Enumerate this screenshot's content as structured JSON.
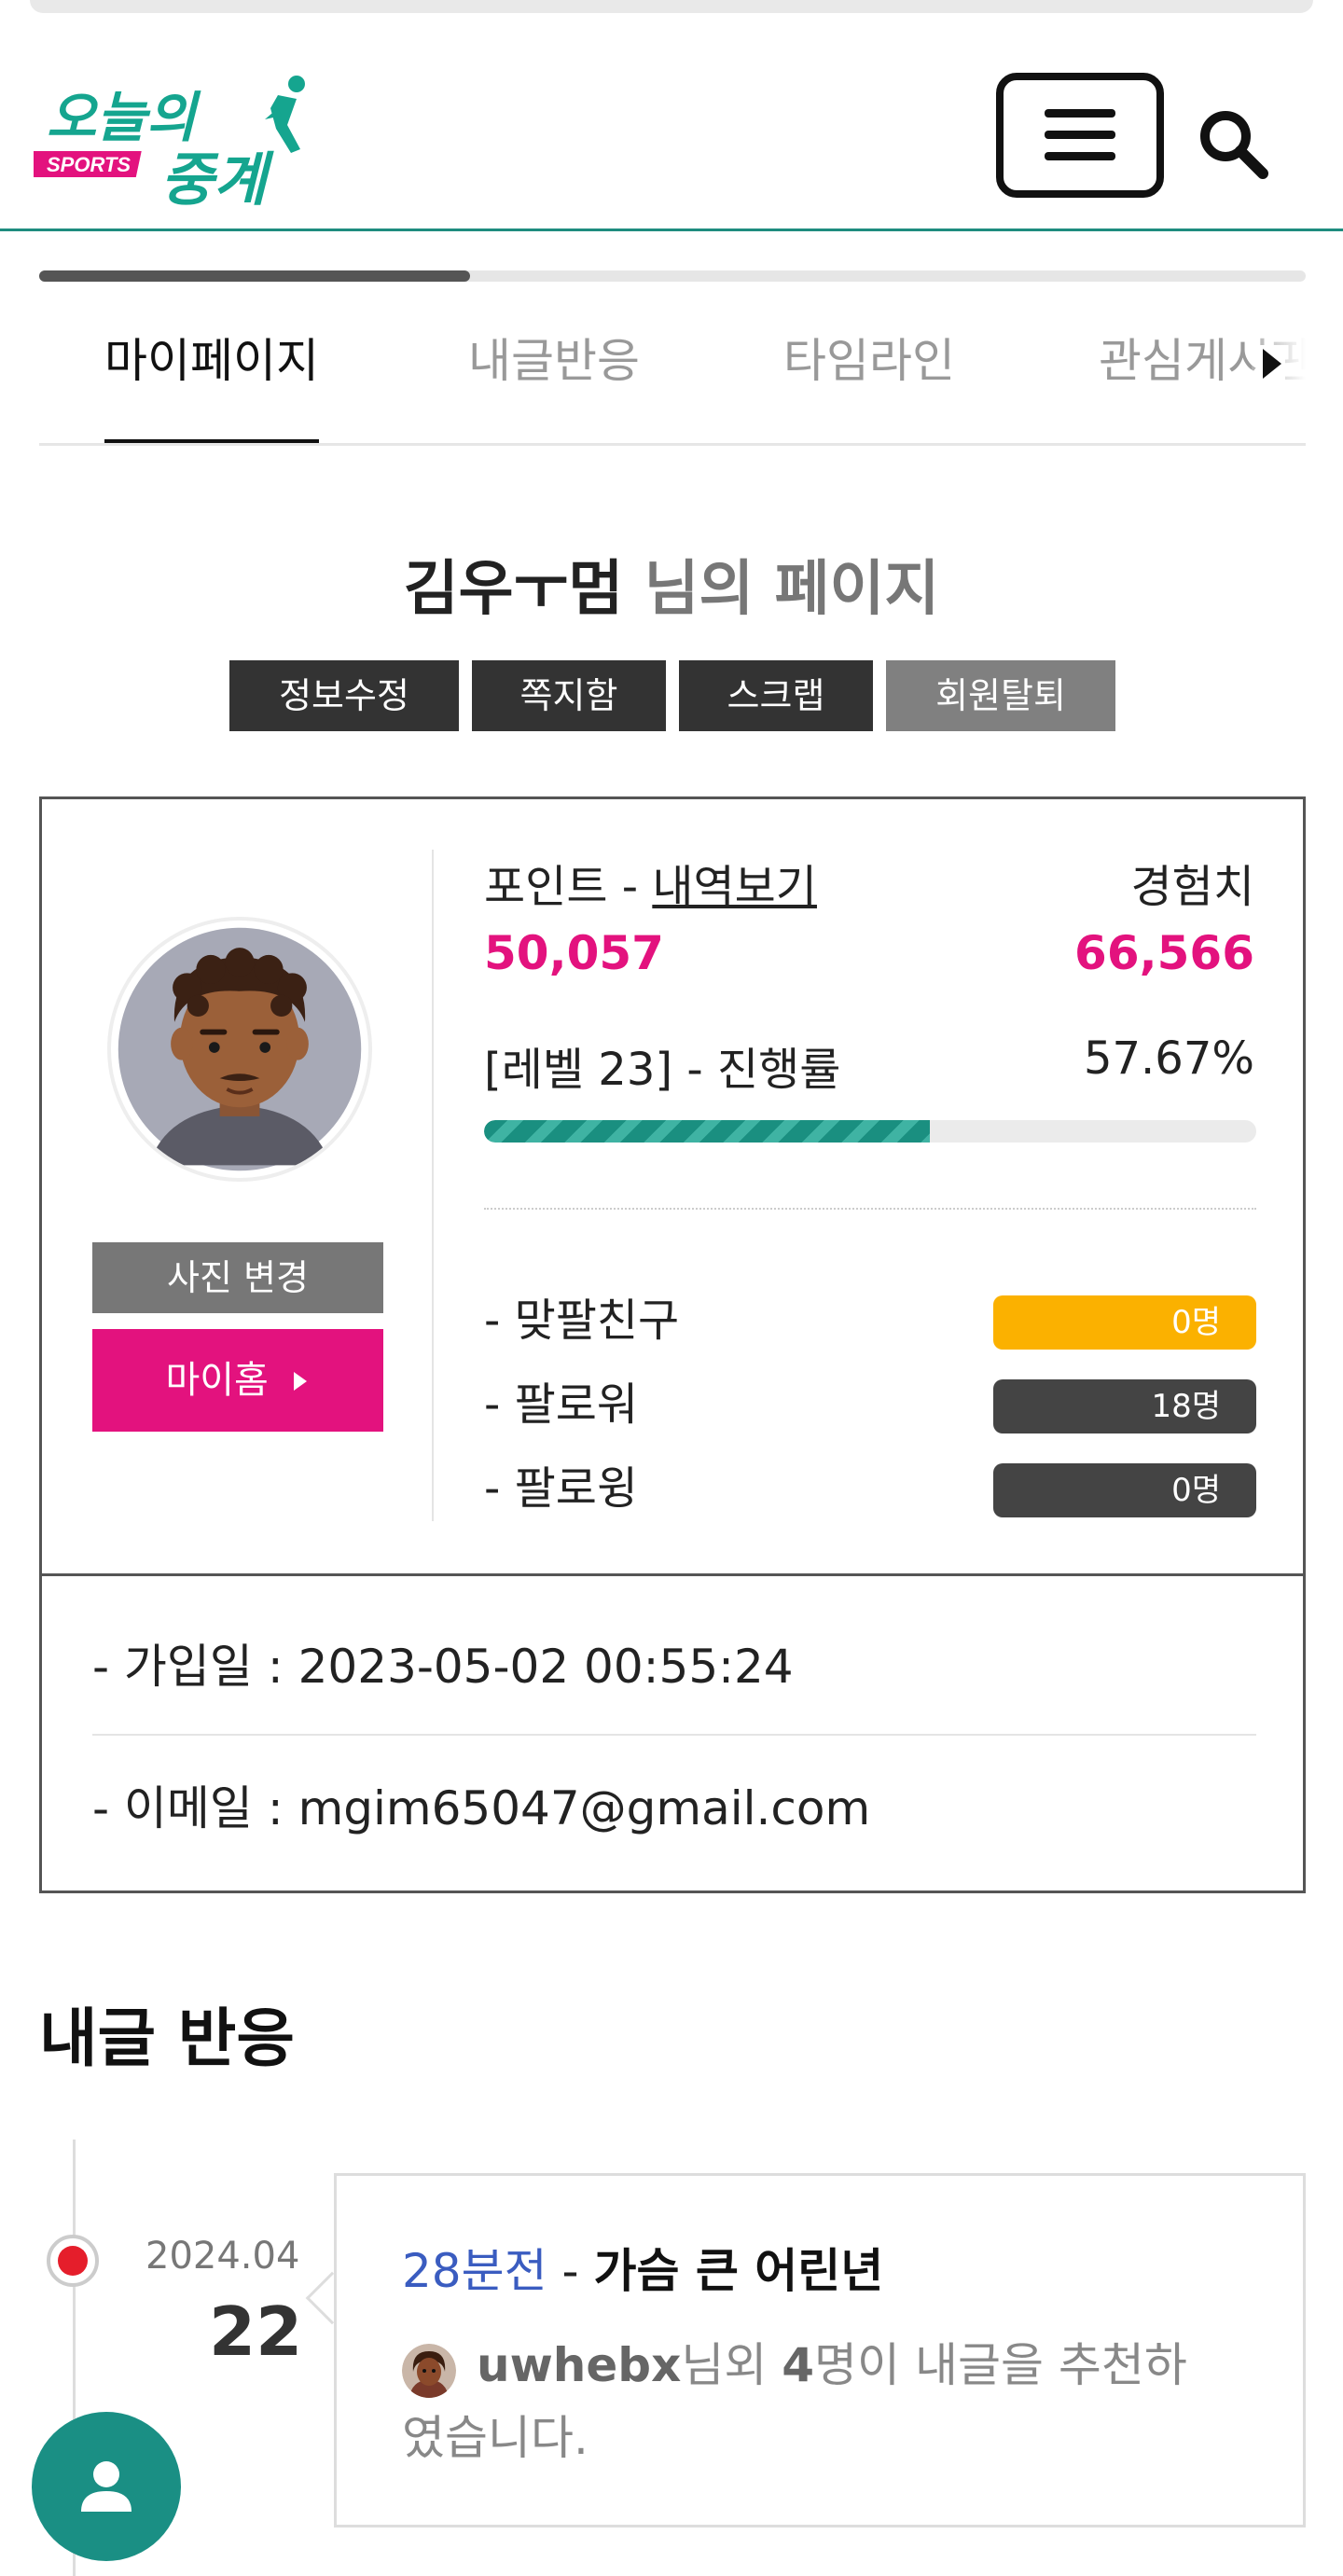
{
  "header": {
    "logo_top": "오늘의",
    "logo_bottom": "중계",
    "logo_badge": "SPORTS"
  },
  "tabs": {
    "active_index": 0,
    "scroll_progress": 0.34,
    "items": [
      {
        "label": "마이페이지"
      },
      {
        "label": "내글반응"
      },
      {
        "label": "타임라인"
      },
      {
        "label": "관심게시판"
      }
    ]
  },
  "profile": {
    "nickname": "김우ㅜ멈",
    "title_suffix": "님의 페이지",
    "actions": [
      "정보수정",
      "쪽지함",
      "스크랩",
      "회원탈퇴"
    ],
    "photo_change_label": "사진 변경",
    "myhome_label": "마이홈",
    "points_label": "포인트 - ",
    "points_link": "내역보기",
    "points_value": "50,057",
    "exp_label": "경험치",
    "exp_value": "66,566",
    "level_label": "[레벨 23] - 진행률",
    "level_percent": "57.67%",
    "level_progress": 0.5767,
    "friends": [
      {
        "label": "- 맞팔친구",
        "count": "0명",
        "color": "#fbb100"
      },
      {
        "label": "- 팔로워",
        "count": "18명",
        "color": "#444444"
      },
      {
        "label": "- 팔로윙",
        "count": "0명",
        "color": "#444444"
      }
    ],
    "join_date": "- 가입일 : 2023-05-02 00:55:24",
    "email": "- 이메일 : mgim65047@gmail.com"
  },
  "reactions": {
    "section_title": "내글 반응",
    "items": [
      {
        "month": "2024.04",
        "day": "22",
        "time_ago": "28분전",
        "separator": " - ",
        "post_title": "가슴 큰 어린년",
        "user": "uwhebx",
        "text_mid": "님외 ",
        "count": "4",
        "text_end": "명이 내글을 추천하였습니다."
      }
    ]
  },
  "colors": {
    "brand_green": "#1a8f84",
    "brand_pink": "#e3127e",
    "accent_yellow": "#fbb100"
  }
}
